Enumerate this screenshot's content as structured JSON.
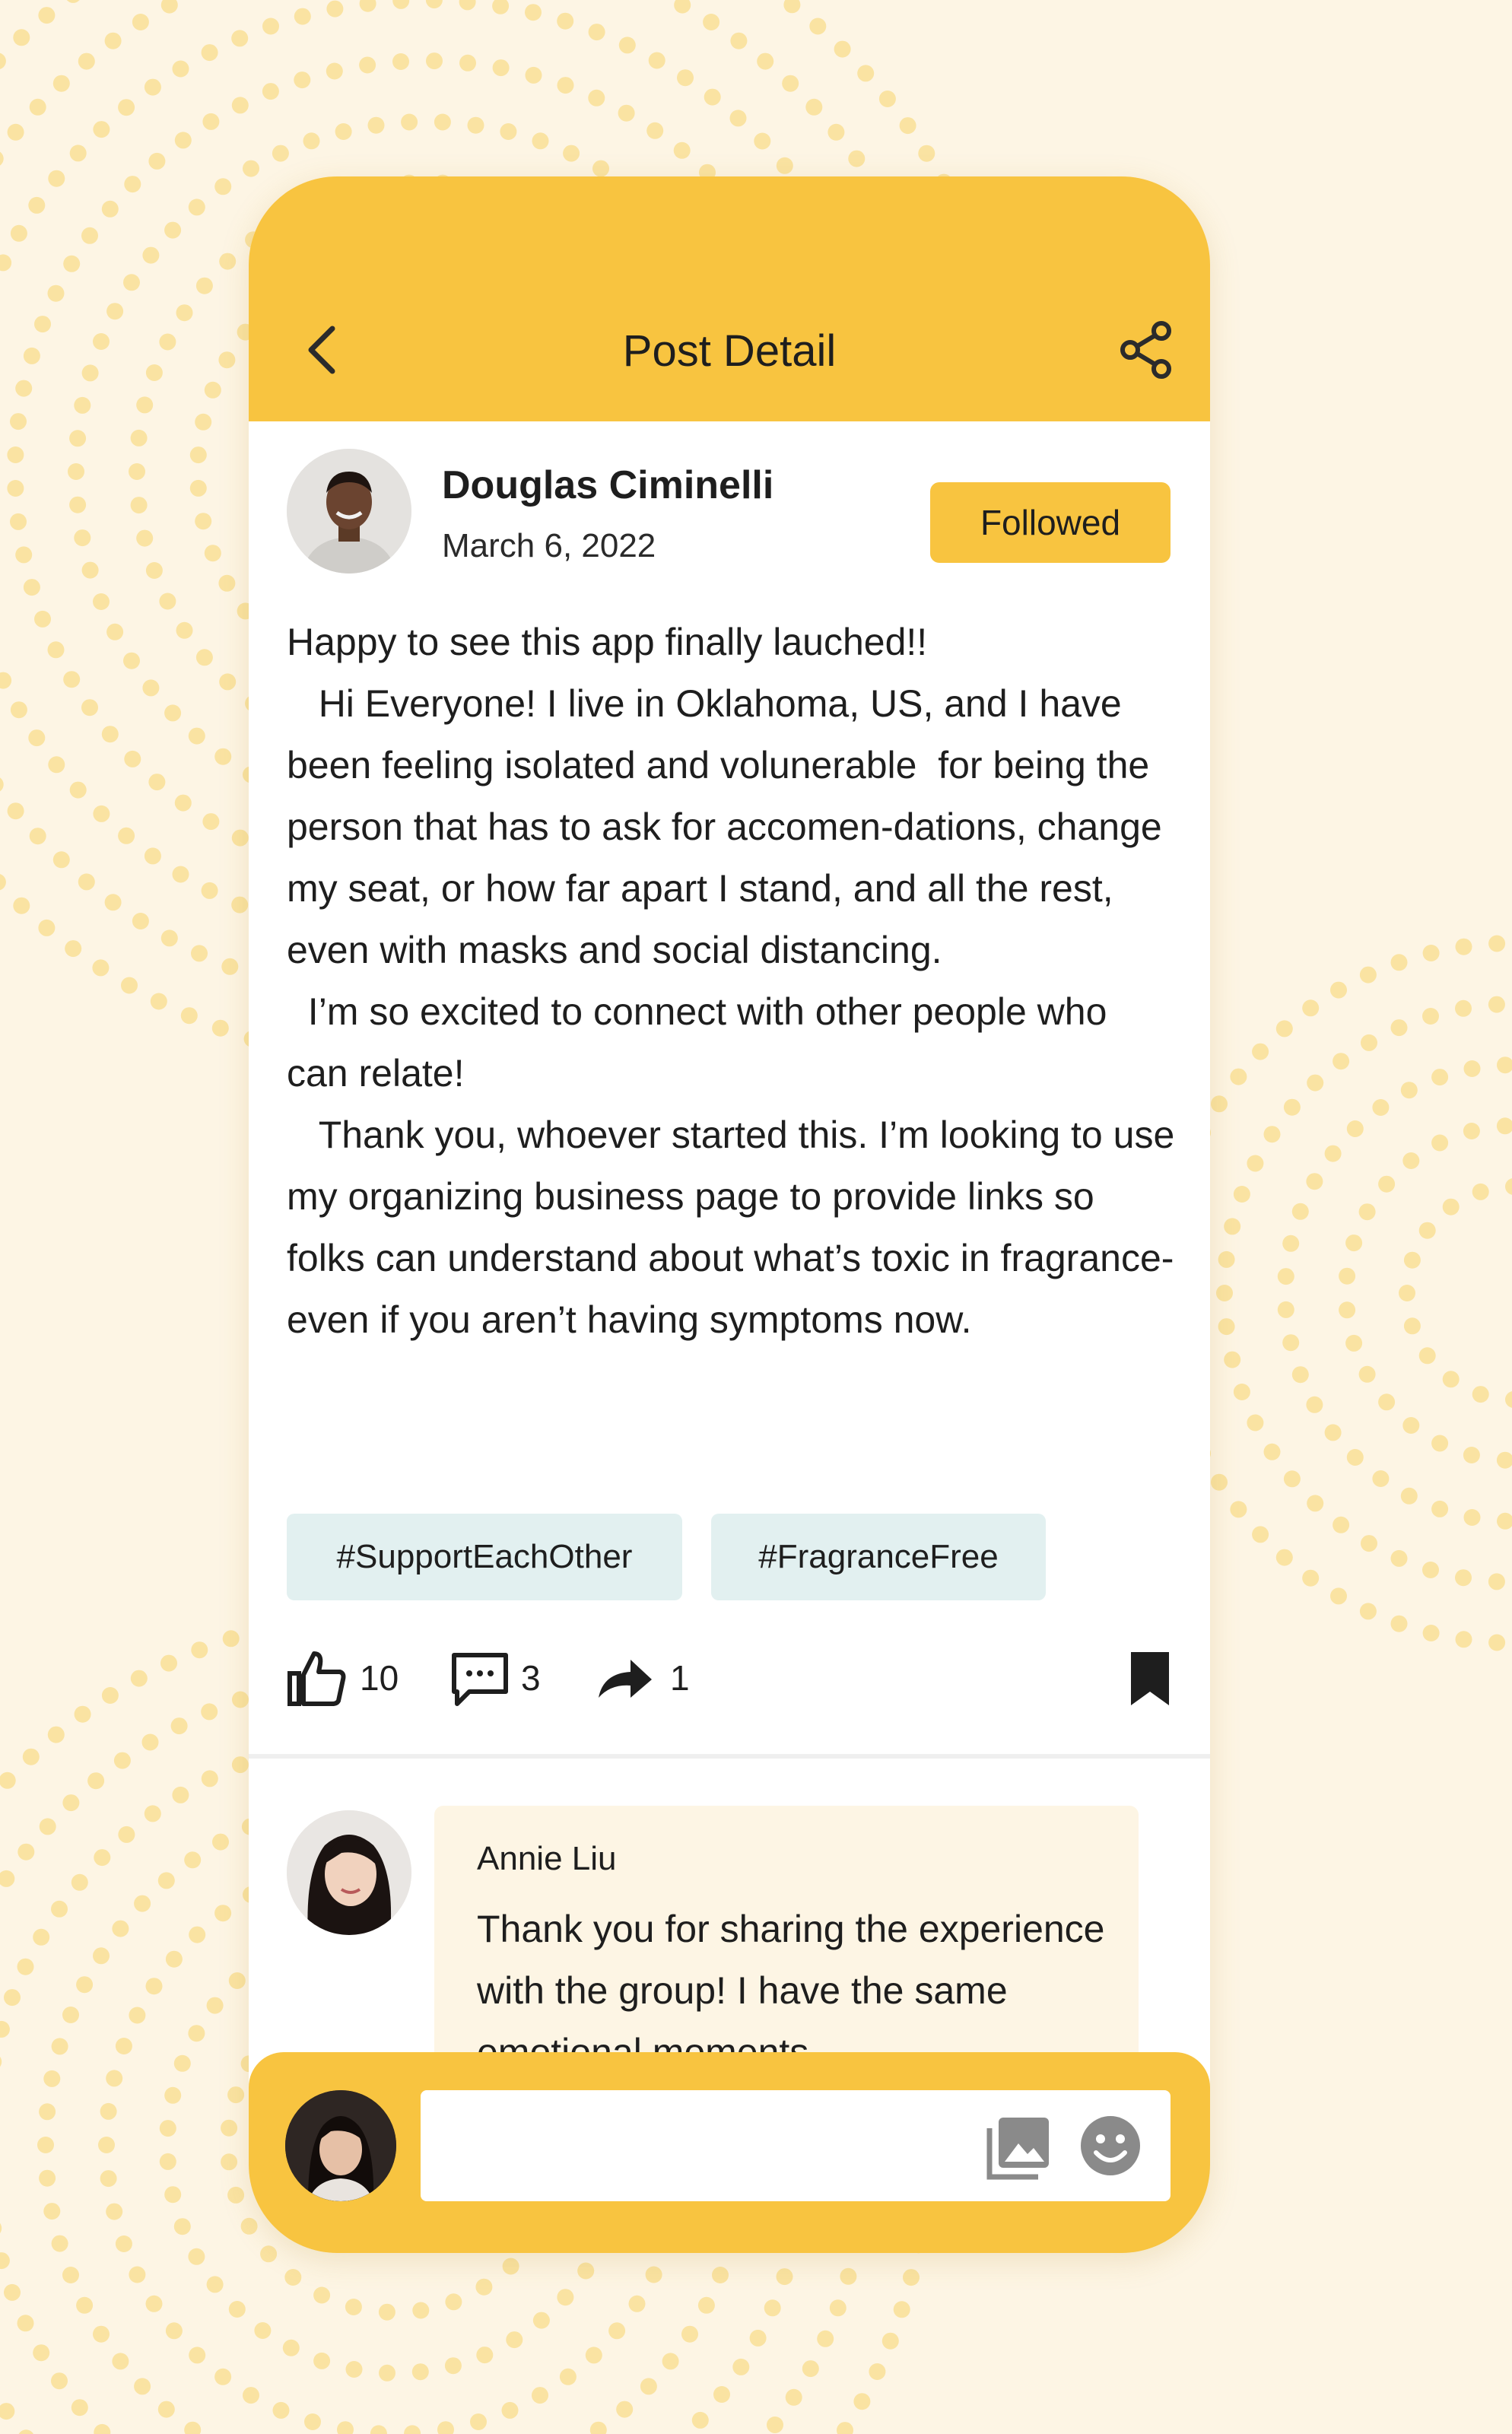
{
  "app": {
    "colors": {
      "background": "#FDF5E4",
      "dots": "#FAE3A2",
      "accent": "#F8C440",
      "tag": "#E2F0F0",
      "comment_bubble": "#FDF5E4",
      "icon_gray": "#8A8A8A"
    }
  },
  "header": {
    "title": "Post Detail",
    "back_icon": "chevron-left-icon",
    "share_icon": "share-icon"
  },
  "post": {
    "author": {
      "name": "Douglas Ciminelli",
      "date": "March 6, 2022",
      "avatar_icon": "avatar"
    },
    "follow_label": "Followed",
    "paragraphs": [
      "Happy to see this app finally lauched!!",
      "   Hi Everyone! I live in Oklahoma, US, and I have been feeling isolated and volunerable  for being the person that has to ask for accomen-dations, change my seat, or how far apart I stand, and all the rest, even with masks and social distancing.",
      "  I’m so excited to connect with other people who can relate!",
      "   Thank you, whoever started this. I’m looking to use my organizing business page to provide links so folks can understand about what’s toxic in fragrance- even if you aren’t having symptoms now."
    ],
    "tags": [
      "#SupportEachOther",
      "#FragranceFree"
    ],
    "stats": {
      "likes": "10",
      "comments": "3",
      "shares": "1"
    },
    "icons": {
      "like": "thumbs-up-icon",
      "comment": "comment-icon",
      "share": "forward-arrow-icon",
      "bookmark": "bookmark-icon"
    }
  },
  "comments": [
    {
      "author": "Annie Liu",
      "text": "Thank you for sharing the experience with the group! I have the same emotional moments"
    }
  ],
  "composer": {
    "placeholder": "",
    "image_icon": "image-icon",
    "emoji_icon": "emoji-icon"
  }
}
